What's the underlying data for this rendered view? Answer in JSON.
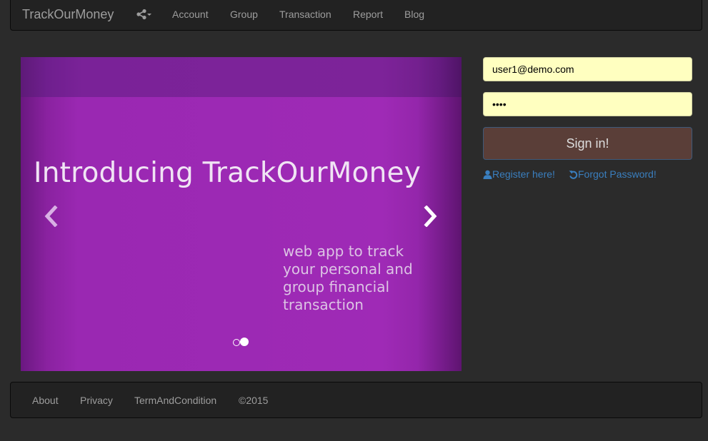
{
  "navbar": {
    "brand": "TrackOurMoney",
    "share_icon": "share-alt-icon",
    "items": [
      {
        "label": "Account"
      },
      {
        "label": "Group"
      },
      {
        "label": "Transaction"
      },
      {
        "label": "Report"
      },
      {
        "label": "Blog"
      }
    ]
  },
  "carousel": {
    "heading": "Introducing TrackOurMoney",
    "caption_lines": [
      "web app to track",
      "your personal and",
      "group financial",
      "transaction"
    ],
    "prev_icon": "chevron-left-icon",
    "next_icon": "chevron-right-icon",
    "slide_count": 2,
    "active_slide": 2,
    "colors": {
      "background": "#9c29b4",
      "top_band": "#7c2399"
    }
  },
  "login": {
    "email_value": "user1@demo.com",
    "password_value": "demo",
    "signin_label": "Sign in!",
    "register_label": "Register here!",
    "register_icon": "user-icon",
    "forgot_label": "Forgot Password!",
    "forgot_icon": "refresh-icon",
    "colors": {
      "input_bg": "#ffffc0",
      "button_bg": "#5a3e38",
      "link": "#3a7fbf"
    }
  },
  "footer": {
    "items": [
      {
        "label": "About"
      },
      {
        "label": "Privacy"
      },
      {
        "label": "TermAndCondition"
      },
      {
        "label": "©2015"
      }
    ]
  }
}
